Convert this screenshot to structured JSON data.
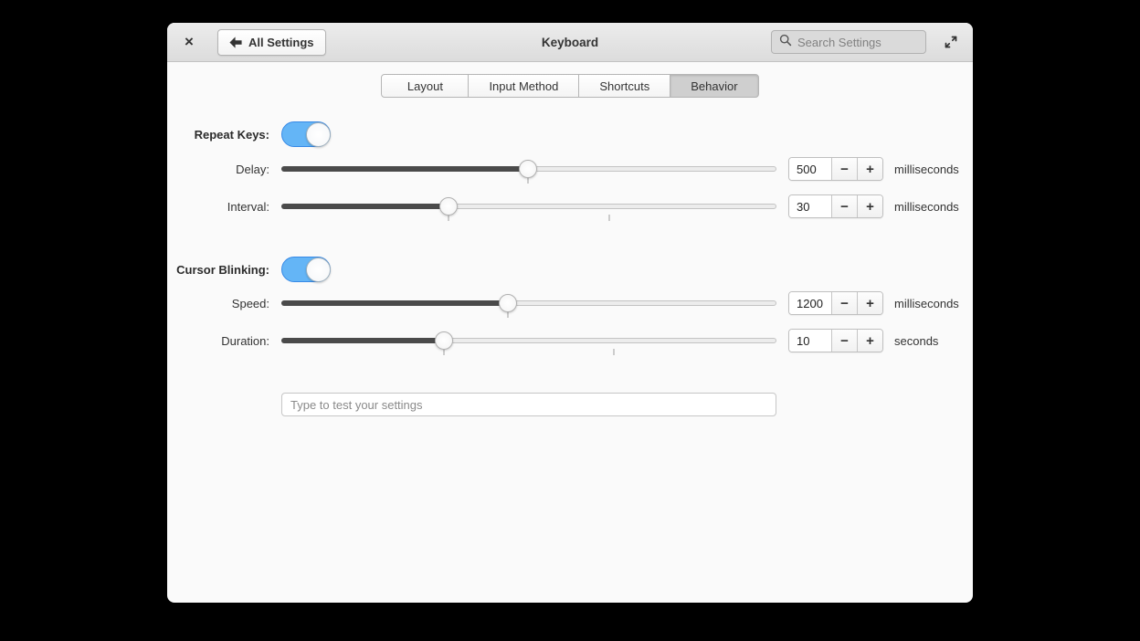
{
  "header": {
    "close": "×",
    "back_label": "All Settings",
    "title": "Keyboard",
    "search_placeholder": "Search Settings"
  },
  "tabs": {
    "items": [
      {
        "label": "Layout",
        "active": false
      },
      {
        "label": "Input Method",
        "active": false
      },
      {
        "label": "Shortcuts",
        "active": false
      },
      {
        "label": "Behavior",
        "active": true
      }
    ]
  },
  "spin": {
    "minus": "−",
    "plus": "+"
  },
  "repeat_keys": {
    "label": "Repeat Keys:",
    "on": true
  },
  "cursor_blinking": {
    "label": "Cursor Blinking:",
    "on": true
  },
  "sliders": {
    "delay": {
      "label": "Delay:",
      "value": "500",
      "unit": "milliseconds",
      "percent": 49.8,
      "tick1": 49.8
    },
    "interval": {
      "label": "Interval:",
      "value": "30",
      "unit": "milliseconds",
      "percent": 33.8,
      "tick1": 33.8,
      "tick2": 66.2
    },
    "speed": {
      "label": "Speed:",
      "value": "1200",
      "unit": "milliseconds",
      "percent": 45.8,
      "tick1": 45.8
    },
    "duration": {
      "label": "Duration:",
      "value": "10",
      "unit": "seconds",
      "percent": 32.8,
      "tick1": 32.8,
      "tick2": 67.2
    }
  },
  "test_input": {
    "placeholder": "Type to test your settings"
  },
  "colors": {
    "accent_blue": "#64b5f6",
    "accent_border": "#3689e6",
    "slider_fill": "#4a4a4a"
  }
}
